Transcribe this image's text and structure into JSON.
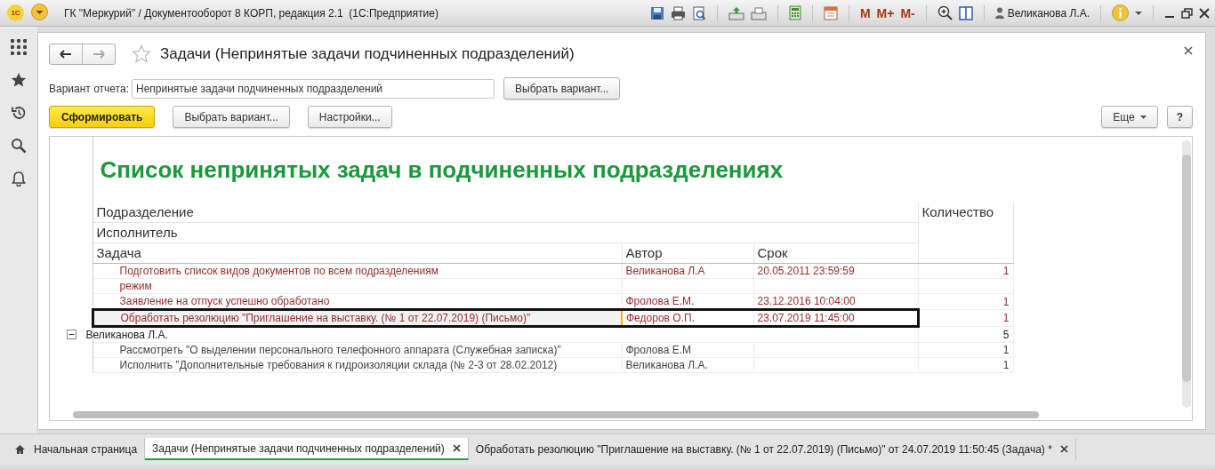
{
  "window": {
    "logo": "1С",
    "title": "ГК \"Меркурий\" / Документооборот 8 КОРП, редакция 2.1  (1С:Предприятие)",
    "memory_buttons": [
      "M",
      "M+",
      "M-"
    ],
    "user": "Великанова Л.А."
  },
  "form": {
    "title": "Задачи (Непринятые задачи подчиненных подразделений)",
    "variant_label": "Вариант отчета:",
    "variant_value": "Непринятые задачи подчиненных подразделений",
    "variant_button": "Выбрать вариант...",
    "commands": [
      {
        "label": "Сформировать",
        "kind": "default"
      },
      {
        "label": "Выбрать вариант...",
        "kind": "plain"
      },
      {
        "label": "Настройки...",
        "kind": "plain"
      }
    ],
    "more_button": "Еще",
    "help_button": "?"
  },
  "report": {
    "title": "Список непринятых задач в подчиненных подразделениях",
    "header_rows": [
      "Подразделение",
      "Исполнитель"
    ],
    "columns": [
      "Задача",
      "Автор",
      "Срок",
      "Количество"
    ],
    "rows": [
      {
        "kind": "task",
        "task": "Подготовить список видов документов по всем подразделениям",
        "author": "Великанова Л.А",
        "due": "20.05.2011 23:59:59",
        "count": "1",
        "overdue": true,
        "selected": false
      },
      {
        "kind": "task",
        "task": "режим",
        "author": "",
        "due": "",
        "count": "",
        "overdue": true,
        "selected": false
      },
      {
        "kind": "task",
        "task": "Заявление на отпуск успешно обработано",
        "author": "Фролова Е.М.",
        "due": "23.12.2016 10:04:00",
        "count": "1",
        "overdue": true,
        "selected": false
      },
      {
        "kind": "task",
        "task": "Обработать резолюцию \"Приглашение на выставку. (№ 1 от 22.07.2019) (Письмо)\"",
        "author": "Федоров О.П.",
        "due": "23.07.2019 11:45:00",
        "count": "1",
        "overdue": true,
        "selected": true
      },
      {
        "kind": "group",
        "name": "Великанова Л.А.",
        "count": "5",
        "expanded": true
      },
      {
        "kind": "task",
        "task": "Рассмотреть \"О выделении персонального телефонного аппарата (Служебная записка)\"",
        "author": "Фролова Е.М",
        "due": "",
        "count": "1",
        "overdue": false,
        "selected": false
      },
      {
        "kind": "task",
        "task": "Исполнить \"Дополнительные требования к гидроизоляции склада (№ 2-3 от 28.02.2012)",
        "author": "Великанова Л.А.",
        "due": "",
        "count": "1",
        "overdue": false,
        "selected": false
      }
    ]
  },
  "tabs": [
    {
      "label": "Начальная страница",
      "kind": "home",
      "selected": false
    },
    {
      "label": "Задачи (Непринятые задачи подчиненных подразделений)",
      "kind": "document",
      "selected": true
    },
    {
      "label": "Обработать резолюцию \"Приглашение на выставку. (№ 1 от 22.07.2019) (Письмо)\" от 24.07.2019 11:50:45 (Задача) *",
      "kind": "document",
      "selected": false
    }
  ]
}
